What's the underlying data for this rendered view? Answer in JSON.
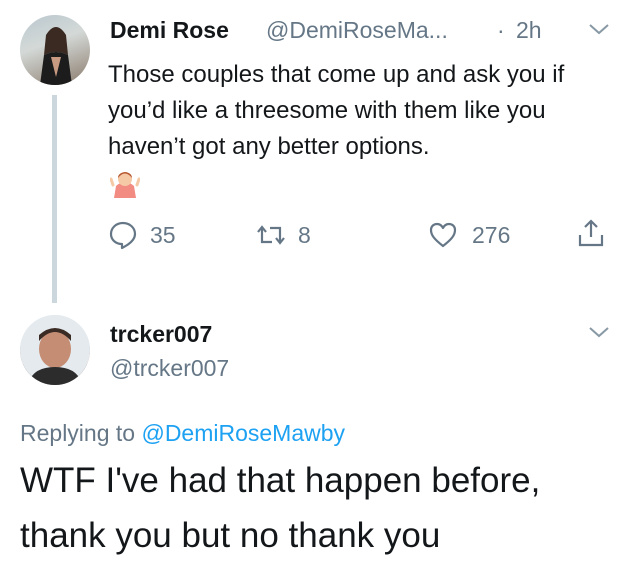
{
  "tweet": {
    "author_name": "Demi Rose",
    "author_handle": "@DemiRoseMa...",
    "separator": "·",
    "time": "2h",
    "text": "Those couples that come up and ask you if you’d like a threesome with them like you haven’t got any better options.",
    "emoji_icon": "person-shrugging-emoji",
    "actions": {
      "reply_count": "35",
      "retweet_count": "8",
      "like_count": "276"
    }
  },
  "reply": {
    "author_name": "trcker007",
    "author_handle": "@trcker007",
    "replying_prefix": "Replying to",
    "replying_to": "@DemiRoseMawby",
    "text": "WTF I've had that happen before, thank you but no thank you"
  },
  "colors": {
    "text_primary": "#14171a",
    "text_secondary": "#657786",
    "link": "#1da1f2",
    "thread_line": "#ccd6dd"
  }
}
